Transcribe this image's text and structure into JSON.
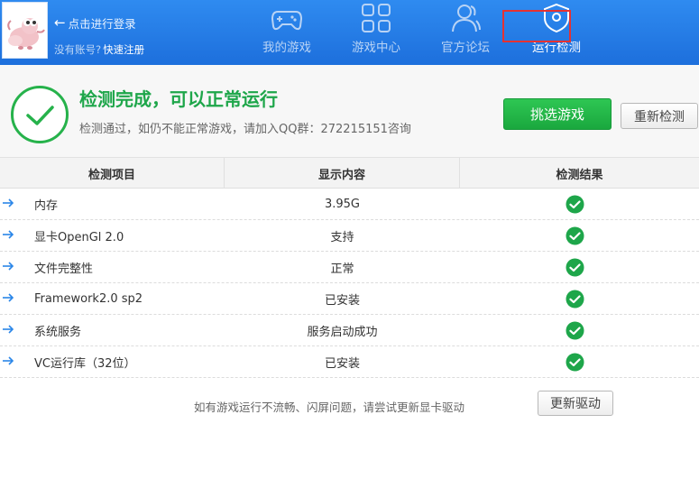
{
  "header": {
    "login_text": "点击进行登录",
    "no_account_text": "没有账号?",
    "register_text": "快速注册",
    "nav": [
      {
        "label": "我的游戏",
        "icon": "gamepad-icon",
        "active": false
      },
      {
        "label": "游戏中心",
        "icon": "grid-icon",
        "active": false
      },
      {
        "label": "官方论坛",
        "icon": "users-icon",
        "active": false
      },
      {
        "label": "运行检测",
        "icon": "shield-icon",
        "active": true
      }
    ]
  },
  "status": {
    "title": "检测完成，可以正常运行",
    "subtitle": "检测通过，如仍不能正常游戏，请加入QQ群：272215151咨询",
    "pick_button": "挑选游戏",
    "recheck_button": "重新检测",
    "icon": "check-circle-icon",
    "color": "#26b24b"
  },
  "table": {
    "headers": [
      "检测项目",
      "显示内容",
      "检测结果"
    ],
    "rows": [
      {
        "name": "内存",
        "value": "3.95G",
        "result": "ok"
      },
      {
        "name": "显卡OpenGl 2.0",
        "value": "支持",
        "result": "ok"
      },
      {
        "name": "文件完整性",
        "value": "正常",
        "result": "ok"
      },
      {
        "name": "Framework2.0 sp2",
        "value": "已安装",
        "result": "ok"
      },
      {
        "name": "系统服务",
        "value": "服务启动成功",
        "result": "ok"
      },
      {
        "name": "VC运行库（32位）",
        "value": "已安装",
        "result": "ok"
      }
    ]
  },
  "footer": {
    "tip": "如有游戏运行不流畅、闪屏问题，请尝试更新显卡驱动",
    "update_button": "更新驱动"
  },
  "colors": {
    "header_blue": "#1d6fdc",
    "success_green": "#1ea64a",
    "highlight_red": "#e53232",
    "arrow_blue": "#2a86e8"
  }
}
